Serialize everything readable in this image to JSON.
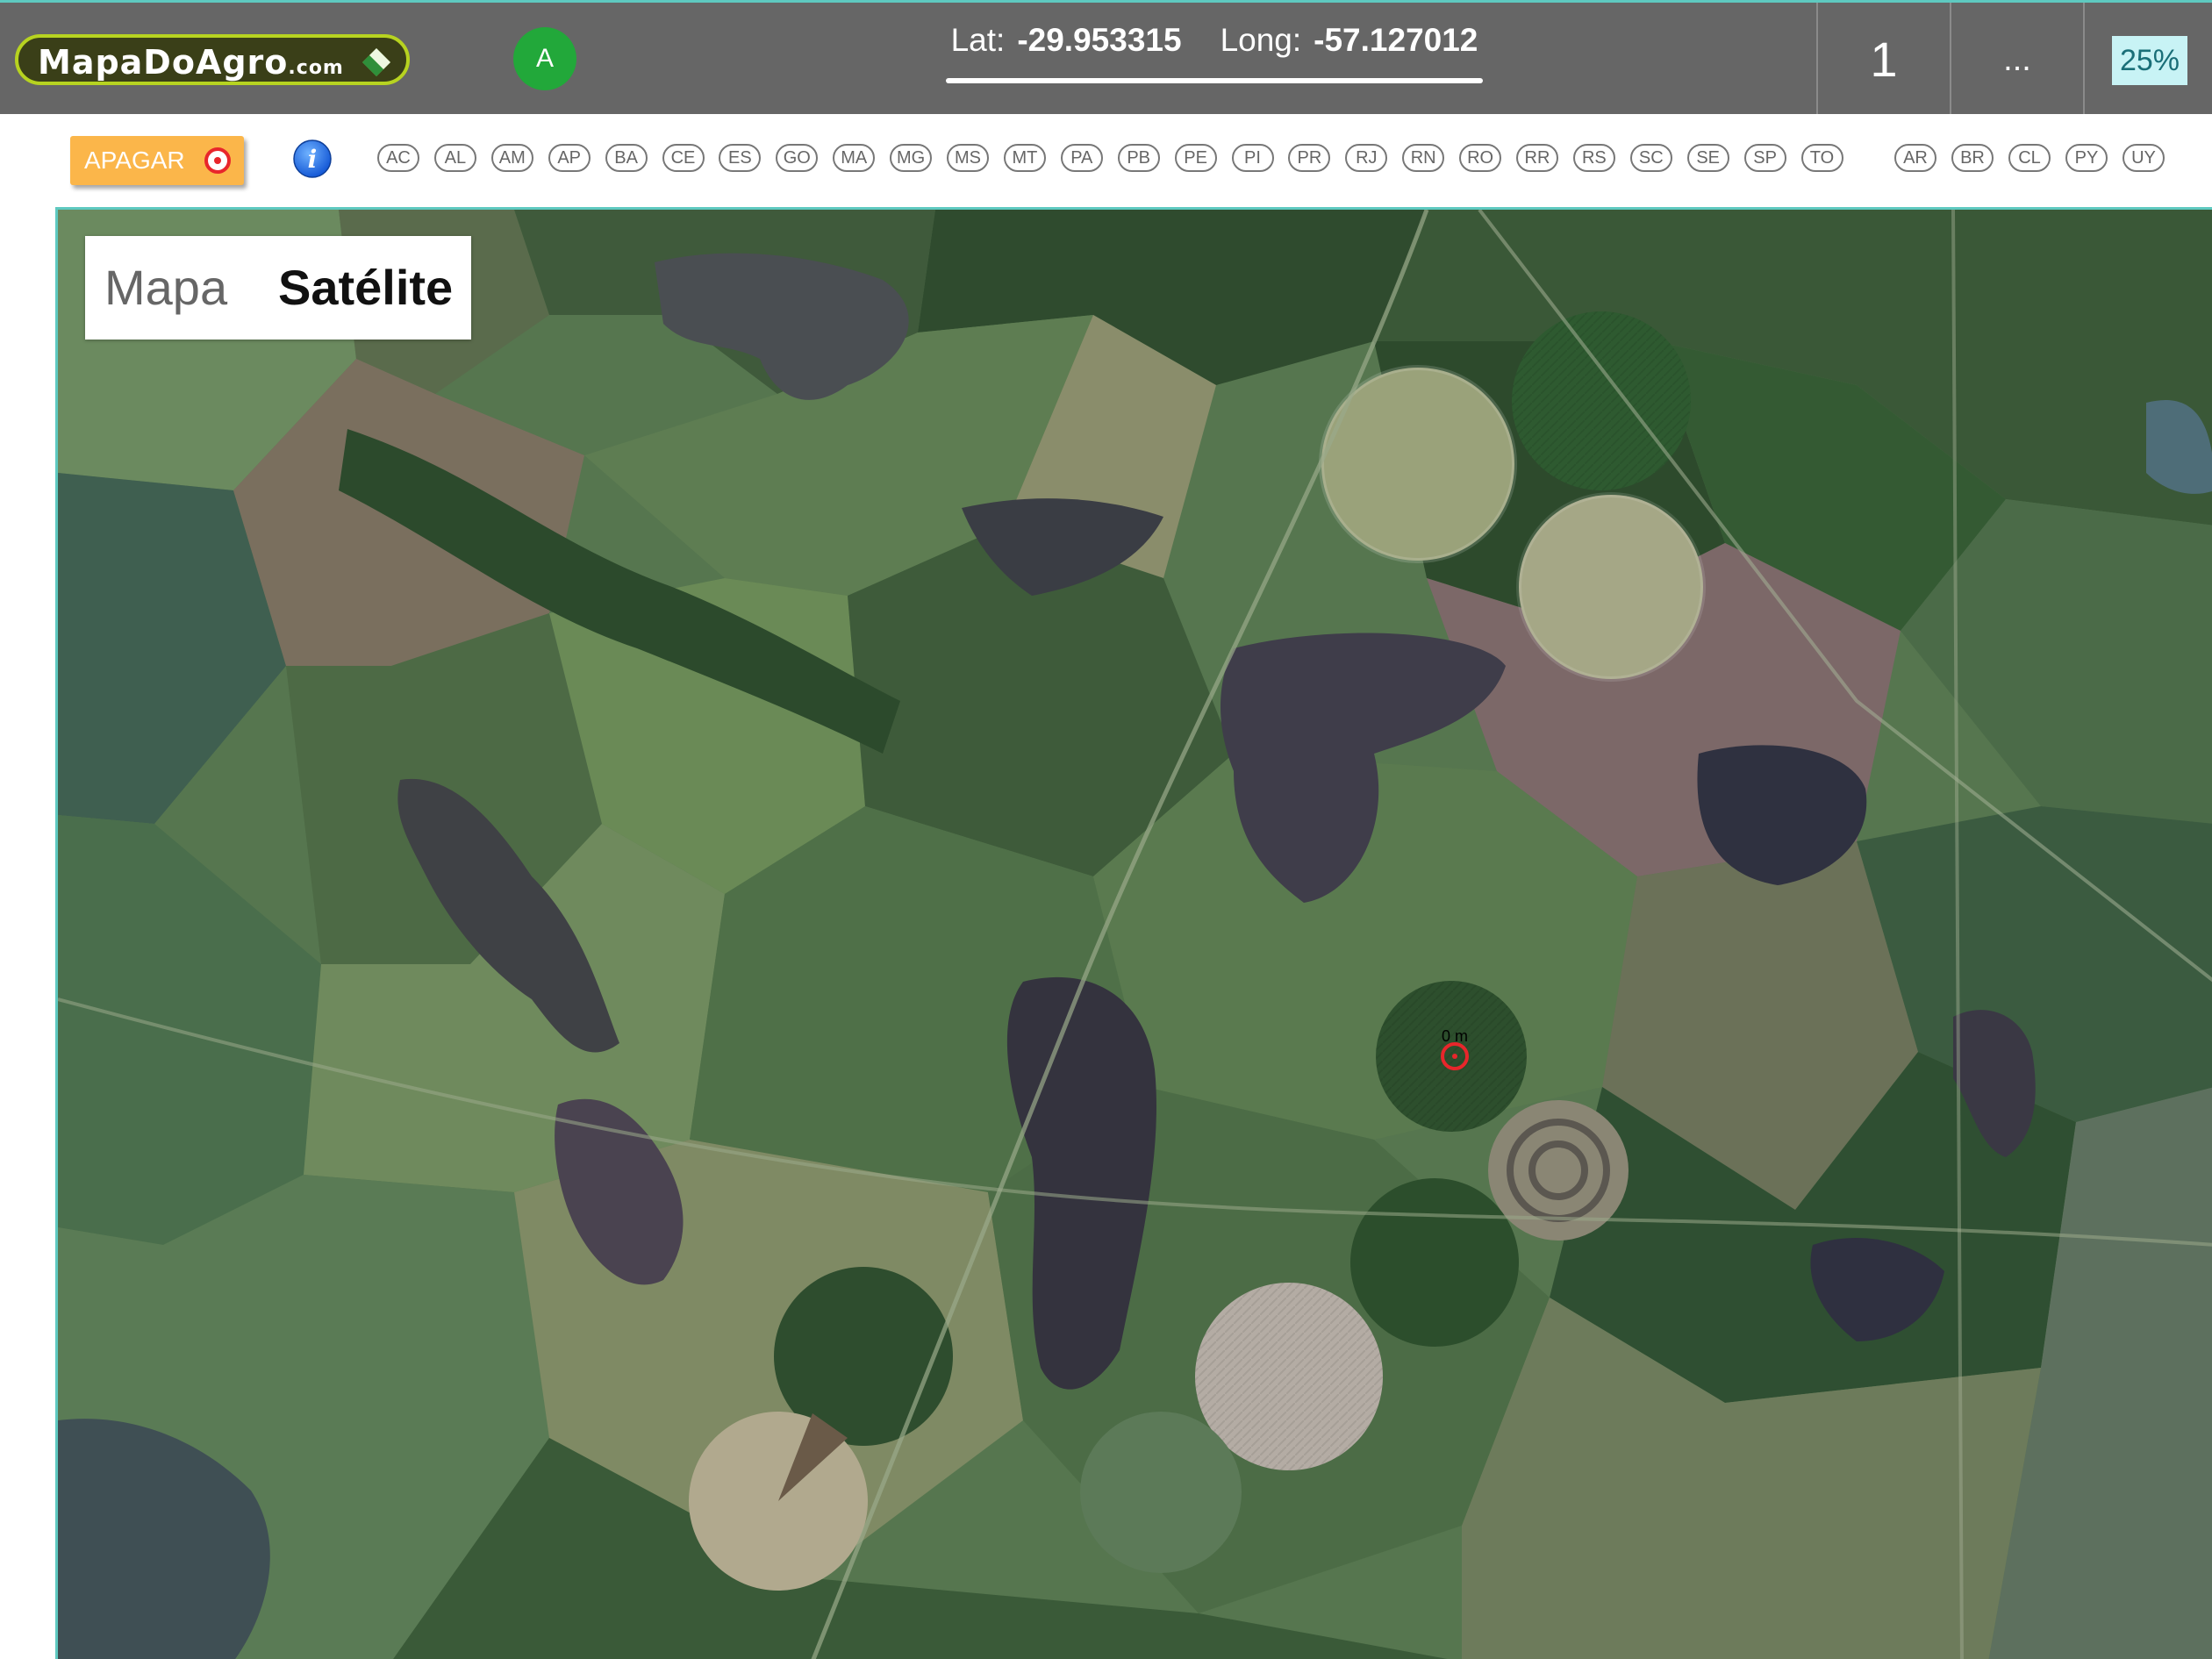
{
  "header": {
    "logo_text": "MapaDoAgro",
    "logo_suffix": ".com",
    "user_initial": "A",
    "lat_label": "Lat:",
    "lat_value": "-29.953315",
    "long_label": "Long:",
    "long_value": "-57.127012",
    "counter": "1",
    "more_label": "...",
    "opacity": "25%"
  },
  "toolbar": {
    "apagar_label": "APAGAR",
    "info_glyph": "i",
    "states": [
      "AC",
      "AL",
      "AM",
      "AP",
      "BA",
      "CE",
      "ES",
      "GO",
      "MA",
      "MG",
      "MS",
      "MT",
      "PA",
      "PB",
      "PE",
      "PI",
      "PR",
      "RJ",
      "RN",
      "RO",
      "RR",
      "RS",
      "SC",
      "SE",
      "SP",
      "TO"
    ],
    "countries": [
      "AR",
      "BR",
      "CL",
      "PY",
      "UY"
    ]
  },
  "map": {
    "type_map_label": "Mapa",
    "type_satellite_label": "Satélite",
    "selected_type": "Satélite",
    "marker_label": "0 m",
    "colors": {
      "accent": "#5ec9c0",
      "marker": "#e8262b",
      "apagar": "#fbb64a"
    }
  }
}
